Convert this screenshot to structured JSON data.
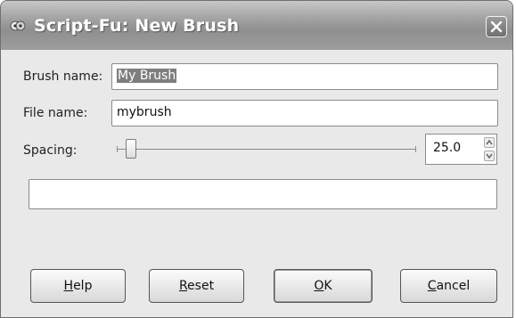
{
  "window": {
    "title": "Script-Fu: New Brush"
  },
  "form": {
    "brush_name": {
      "label": "Brush name:",
      "value": "My Brush"
    },
    "file_name": {
      "label": "File name:",
      "value": "mybrush"
    },
    "spacing": {
      "label": "Spacing:",
      "value": "25.0",
      "level_percent": 2
    },
    "empty_field": {
      "value": ""
    }
  },
  "buttons": {
    "help": {
      "mnemonic": "H",
      "rest": "elp"
    },
    "reset": {
      "mnemonic": "R",
      "rest": "eset"
    },
    "ok": {
      "mnemonic": "O",
      "rest": "K"
    },
    "cancel": {
      "mnemonic": "C",
      "rest": "ancel"
    }
  },
  "icons": {
    "app": "script-fu-icon",
    "close": "close-icon"
  }
}
